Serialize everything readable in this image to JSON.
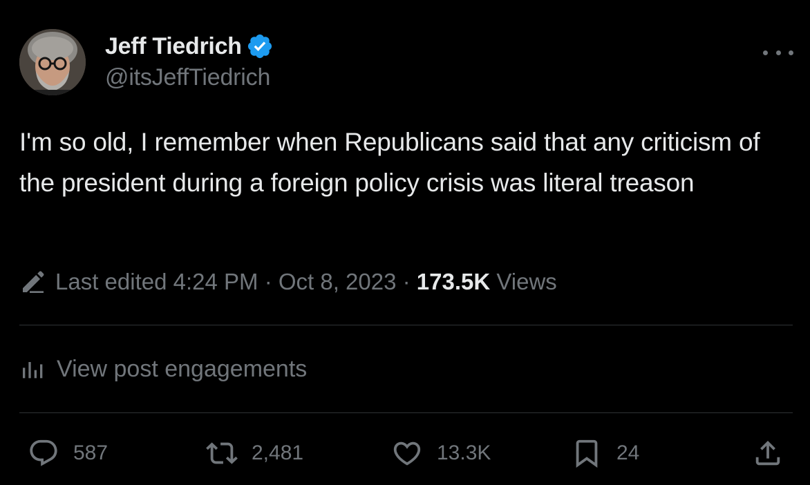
{
  "author": {
    "name": "Jeff Tiedrich",
    "handle": "@itsJeffTiedrich",
    "verified": true
  },
  "post": {
    "text": "I'm so old, I remember when Republicans said that any criticism of the president during a foreign policy crisis was literal treason"
  },
  "meta": {
    "edited_label": "Last edited 4:24 PM · Oct 8, 2023 · ",
    "views_count": "173.5K",
    "views_label": " Views"
  },
  "engagements_link": "View post engagements",
  "actions": {
    "replies": "587",
    "reposts": "2,481",
    "likes": "13.3K",
    "bookmarks": "24"
  },
  "icons": {
    "verified": "verified-badge-icon",
    "more": "more-icon",
    "edit": "pencil-icon",
    "engagements": "bar-chart-icon",
    "reply": "reply-icon",
    "repost": "repost-icon",
    "like": "heart-icon",
    "bookmark": "bookmark-icon",
    "share": "share-icon"
  },
  "colors": {
    "background": "#000000",
    "text": "#e7e9ea",
    "muted": "#71767b",
    "verified_blue": "#1d9bf0",
    "divider": "#2f3336"
  }
}
